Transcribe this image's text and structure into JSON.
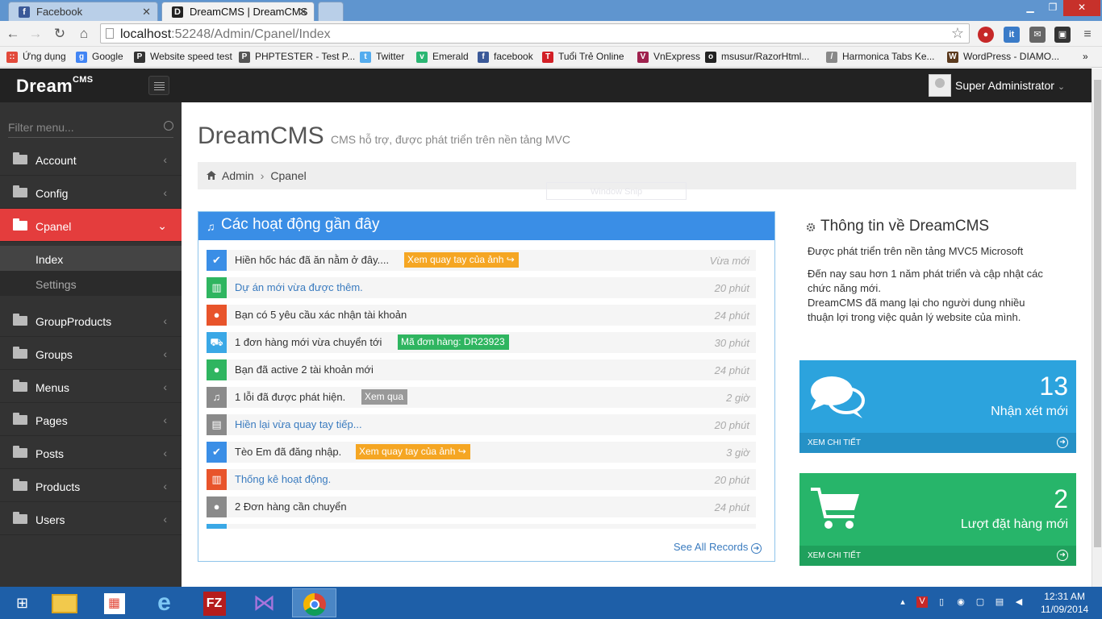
{
  "browser": {
    "tabs": [
      {
        "title": "Facebook",
        "icon": "facebook-icon",
        "color": "#3b5998",
        "glyph": "f"
      },
      {
        "title": "DreamCMS | DreamCMS",
        "icon": "dreamcms-icon",
        "color": "#222222",
        "glyph": "D"
      }
    ],
    "url_host": "localhost",
    "url_path": ":52248/Admin/Cpanel/Index",
    "bookmarks": [
      {
        "label": "Ứng dụng",
        "color": "#e24a3b",
        "glyph": "::"
      },
      {
        "label": "Google",
        "color": "#4285f4",
        "glyph": "g"
      },
      {
        "label": "Website speed test",
        "color": "#333333",
        "glyph": "P"
      },
      {
        "label": "PHPTESTER - Test P...",
        "color": "#555555",
        "glyph": "P"
      },
      {
        "label": "Twitter",
        "color": "#55acee",
        "glyph": "t"
      },
      {
        "label": "Emerald",
        "color": "#2bb673",
        "glyph": "v"
      },
      {
        "label": "facebook",
        "color": "#3b5998",
        "glyph": "f"
      },
      {
        "label": "Tuổi Trẻ Online",
        "color": "#d21f26",
        "glyph": "T"
      },
      {
        "label": "VnExpress",
        "color": "#9f224e",
        "glyph": "V"
      },
      {
        "label": "msusur/RazorHtml...",
        "color": "#222222",
        "glyph": "o"
      },
      {
        "label": "Harmonica Tabs Ke...",
        "color": "#888888",
        "glyph": "/"
      },
      {
        "label": "WordPress - DIAMO...",
        "color": "#5b3a1e",
        "glyph": "W"
      }
    ]
  },
  "header": {
    "logo": "Dream",
    "logo_sup": "CMS",
    "user": "Super Administrator"
  },
  "sidebar": {
    "filter_placeholder": "Filter menu...",
    "items": [
      {
        "label": "Account"
      },
      {
        "label": "Config"
      },
      {
        "label": "Cpanel"
      },
      {
        "label": "GroupProducts"
      },
      {
        "label": "Groups"
      },
      {
        "label": "Menus"
      },
      {
        "label": "Pages"
      },
      {
        "label": "Posts"
      },
      {
        "label": "Products"
      },
      {
        "label": "Users"
      }
    ],
    "subitems": [
      {
        "label": "Index"
      },
      {
        "label": "Settings"
      }
    ]
  },
  "page": {
    "title": "DreamCMS",
    "subtitle": "CMS hỗ trợ, được phát triển trên nền tảng MVC",
    "breadcrumb": [
      "Admin",
      "Cpanel"
    ],
    "ghost": "Window Snip"
  },
  "activity": {
    "title": "Các hoạt động gần đây",
    "see_all": "See All Records",
    "rows": [
      {
        "icon": "check-icon",
        "glyph": "✔",
        "color": "#3a8ee6",
        "text": "Hiền hốc hác đã ăn nằm ở đây....",
        "link": false,
        "tag": "Xem quay tay của ảnh ↪",
        "tag_color": "#f5a623",
        "time": "Vừa mới"
      },
      {
        "icon": "chart-icon",
        "glyph": "▥",
        "color": "#2fb560",
        "text": "Dự án mới vừa được thêm.",
        "link": true,
        "tag": "",
        "tag_color": "",
        "time": "20 phút"
      },
      {
        "icon": "user-icon",
        "glyph": "●",
        "color": "#e8542b",
        "text": "Bạn có 5 yêu cầu xác nhận tài khoản",
        "link": false,
        "tag": "",
        "tag_color": "",
        "time": "24 phút"
      },
      {
        "icon": "cart-icon",
        "glyph": "⛟",
        "color": "#3aa8e6",
        "text": "1 đơn hàng mới vừa chuyển tới",
        "link": false,
        "tag": "Mã đơn hàng: DR23923",
        "tag_color": "#2fb560",
        "time": "30 phút"
      },
      {
        "icon": "user-icon",
        "glyph": "●",
        "color": "#2fb560",
        "text": "Bạn đã active 2 tài khoản mới",
        "link": false,
        "tag": "",
        "tag_color": "",
        "time": "24 phút"
      },
      {
        "icon": "bell-icon",
        "glyph": "♫",
        "color": "#8a8a8a",
        "text": "1 lỗi đã được phát hiện.",
        "link": false,
        "tag": "Xem qua",
        "tag_color": "#999999",
        "time": "2 giờ"
      },
      {
        "icon": "briefcase-icon",
        "glyph": "▤",
        "color": "#8a8a8a",
        "text": "Hiền lại vừa quay tay tiếp...",
        "link": true,
        "tag": "",
        "tag_color": "",
        "time": "20 phút"
      },
      {
        "icon": "check-icon",
        "glyph": "✔",
        "color": "#3a8ee6",
        "text": "Tèo Em đã đăng nhập.",
        "link": false,
        "tag": "Xem quay tay của ảnh ↪",
        "tag_color": "#f5a623",
        "time": "3 giờ"
      },
      {
        "icon": "chart-icon",
        "glyph": "▥",
        "color": "#e8542b",
        "text": "Thống kê hoạt động.",
        "link": true,
        "tag": "",
        "tag_color": "",
        "time": "20 phút"
      },
      {
        "icon": "user-icon",
        "glyph": "●",
        "color": "#8a8a8a",
        "text": "2 Đơn hàng cần chuyển",
        "link": false,
        "tag": "",
        "tag_color": "",
        "time": "24 phút"
      }
    ]
  },
  "info": {
    "title": "Thông tin về DreamCMS",
    "line1": "Được phát triển trên nền tảng MVC5 Microsoft",
    "line2": "Đến nay sau hơn 1 năm phát triển và cập nhật các",
    "line3": "chức năng mới.",
    "line4": "DreamCMS đã mang lại cho người dung nhiều",
    "line5": "thuận lợi trong việc quản lý website của mình."
  },
  "stats": [
    {
      "value": "13",
      "label": "Nhận xét mới",
      "footer": "XEM CHI TIẾT",
      "color": "#2ca3dd",
      "foot_color": "#2591c6"
    },
    {
      "value": "2",
      "label": "Lượt đặt hàng mới",
      "footer": "XEM CHI TIẾT",
      "color": "#27b56a",
      "foot_color": "#1fa05c"
    }
  ],
  "taskbar": {
    "time": "12:31 AM",
    "date": "11/09/2014"
  }
}
